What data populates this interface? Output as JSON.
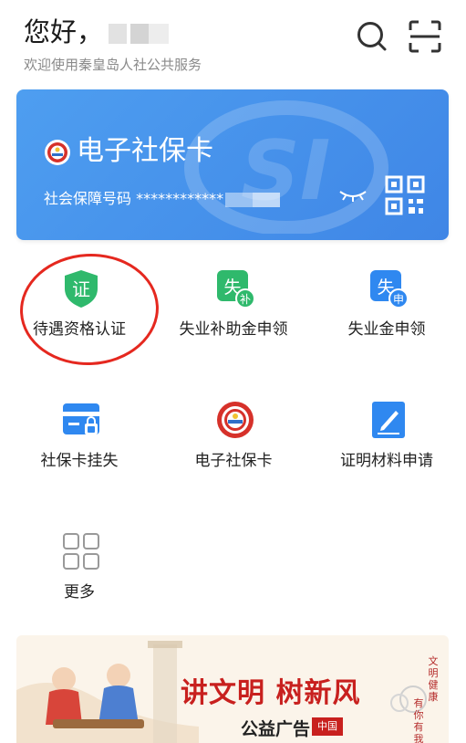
{
  "header": {
    "greeting": "您好，",
    "subtitle": "欢迎使用秦皇岛人社公共服务",
    "search_icon": "search-icon",
    "scan_icon": "scan-icon"
  },
  "card": {
    "title": "电子社保卡",
    "number_label": "社会保障号码",
    "number_masked": "************",
    "eye_icon": "eye-closed-icon",
    "qr_icon": "qr-code-icon"
  },
  "services": [
    {
      "label": "待遇资格认证",
      "icon": "certify-shield-icon",
      "icon_text": "证"
    },
    {
      "label": "失业补助金申领",
      "icon": "unemployment-subsidy-icon",
      "icon_text": "失",
      "badge_text": "补"
    },
    {
      "label": "失业金申领",
      "icon": "unemployment-benefit-icon",
      "icon_text": "失",
      "badge_text": "申"
    },
    {
      "label": "社保卡挂失",
      "icon": "card-lock-icon"
    },
    {
      "label": "电子社保卡",
      "icon": "social-security-emblem-icon"
    },
    {
      "label": "证明材料申请",
      "icon": "edit-document-icon"
    },
    {
      "label": "更多",
      "icon": "grid-more-icon"
    }
  ],
  "banner": {
    "slogan": "讲文明 树新风",
    "sub": "公益广告",
    "china_mark": "中国",
    "vertical_text_1": "文明健康",
    "vertical_text_2": "有你有我"
  },
  "colors": {
    "card_blue": "#4a95ee",
    "green": "#2fb96c",
    "blue": "#2f88f0",
    "red_mark": "#e5281f"
  }
}
